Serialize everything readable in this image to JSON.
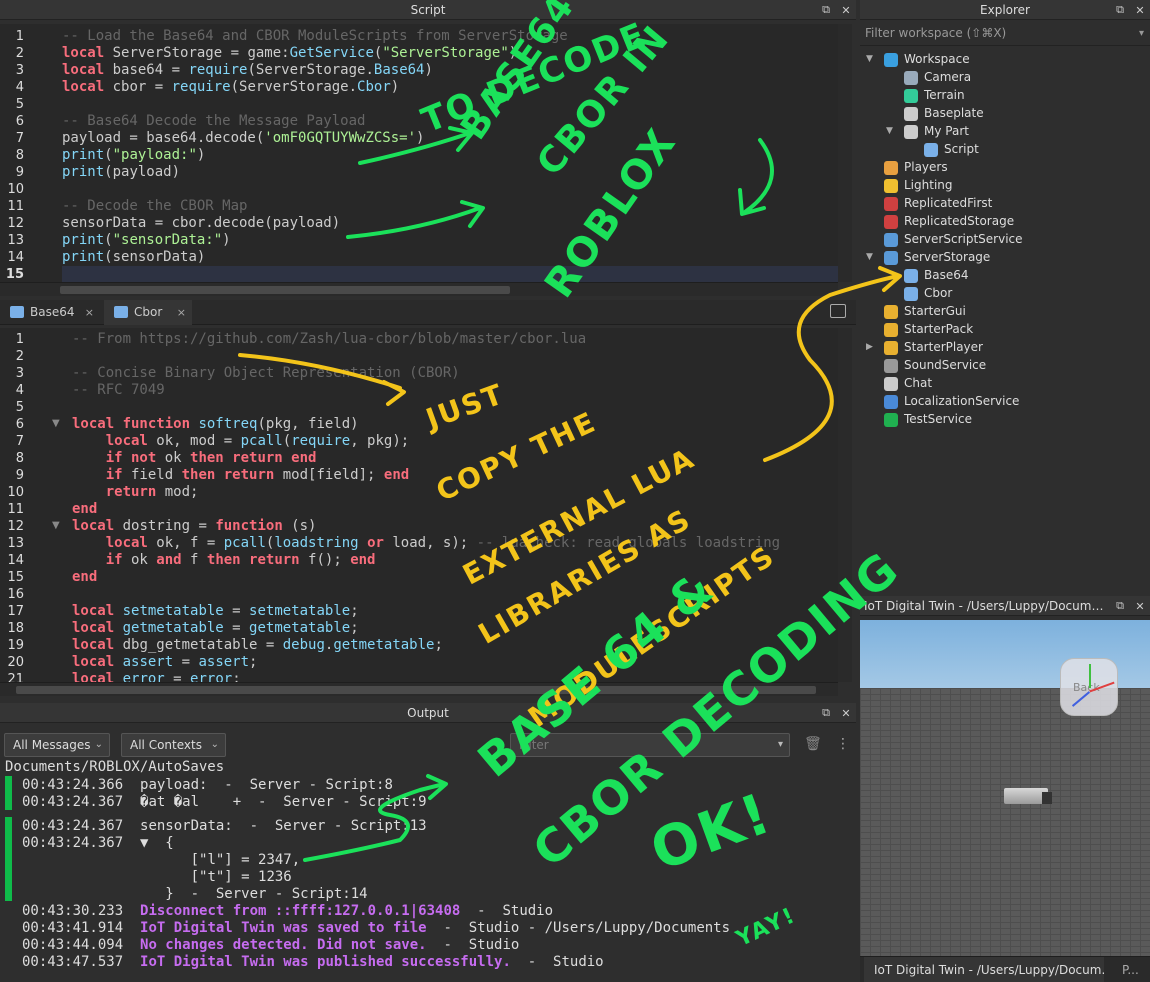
{
  "script_panel": {
    "title": "Script",
    "lines": [
      [
        {
          "c": "cm",
          "t": "-- Load the Base64 and CBOR ModuleScripts from ServerStorage"
        }
      ],
      [
        {
          "c": "kw",
          "t": "local"
        },
        {
          "c": "tx",
          "t": " ServerStorage = game:"
        },
        {
          "c": "bi",
          "t": "GetService"
        },
        {
          "c": "tx",
          "t": "("
        },
        {
          "c": "st",
          "t": "\"ServerStorage\""
        },
        {
          "c": "tx",
          "t": ")"
        }
      ],
      [
        {
          "c": "kw",
          "t": "local"
        },
        {
          "c": "tx",
          "t": " base64 = "
        },
        {
          "c": "bi",
          "t": "require"
        },
        {
          "c": "tx",
          "t": "(ServerStorage."
        },
        {
          "c": "bi",
          "t": "Base64"
        },
        {
          "c": "tx",
          "t": ")"
        }
      ],
      [
        {
          "c": "kw",
          "t": "local"
        },
        {
          "c": "tx",
          "t": " cbor = "
        },
        {
          "c": "bi",
          "t": "require"
        },
        {
          "c": "tx",
          "t": "(ServerStorage."
        },
        {
          "c": "bi",
          "t": "Cbor"
        },
        {
          "c": "tx",
          "t": ")"
        }
      ],
      [],
      [
        {
          "c": "cm",
          "t": "-- Base64 Decode the Message Payload"
        }
      ],
      [
        {
          "c": "tx",
          "t": "payload = base64.decode("
        },
        {
          "c": "st",
          "t": "'omF0GQTUYWwZCSs='"
        },
        {
          "c": "tx",
          "t": ")"
        }
      ],
      [
        {
          "c": "bi",
          "t": "print"
        },
        {
          "c": "tx",
          "t": "("
        },
        {
          "c": "st",
          "t": "\"payload:\""
        },
        {
          "c": "tx",
          "t": ")"
        }
      ],
      [
        {
          "c": "bi",
          "t": "print"
        },
        {
          "c": "tx",
          "t": "(payload)"
        }
      ],
      [],
      [
        {
          "c": "cm",
          "t": "-- Decode the CBOR Map"
        }
      ],
      [
        {
          "c": "tx",
          "t": "sensorData = cbor.decode(payload)"
        }
      ],
      [
        {
          "c": "bi",
          "t": "print"
        },
        {
          "c": "tx",
          "t": "("
        },
        {
          "c": "st",
          "t": "\"sensorData:\""
        },
        {
          "c": "tx",
          "t": ")"
        }
      ],
      [
        {
          "c": "bi",
          "t": "print"
        },
        {
          "c": "tx",
          "t": "(sensorData)"
        }
      ],
      []
    ]
  },
  "tabs": [
    {
      "label": "Base64",
      "close": "×"
    },
    {
      "label": "Cbor",
      "close": "×"
    }
  ],
  "cbor_panel": {
    "lines": [
      [
        {
          "c": "cm",
          "t": "-- From https://github.com/Zash/lua-cbor/blob/master/cbor.lua"
        }
      ],
      [],
      [
        {
          "c": "cm",
          "t": "-- Concise Binary Object Representation (CBOR)"
        }
      ],
      [
        {
          "c": "cm",
          "t": "-- RFC 7049"
        }
      ],
      [],
      [
        {
          "c": "kw",
          "t": "local function"
        },
        {
          "c": "tx",
          "t": " "
        },
        {
          "c": "bi",
          "t": "softreq"
        },
        {
          "c": "tx",
          "t": "(pkg, field)"
        }
      ],
      [
        {
          "c": "tx",
          "t": "    "
        },
        {
          "c": "kw",
          "t": "local"
        },
        {
          "c": "tx",
          "t": " ok, mod = "
        },
        {
          "c": "bi",
          "t": "pcall"
        },
        {
          "c": "tx",
          "t": "("
        },
        {
          "c": "bi",
          "t": "require"
        },
        {
          "c": "tx",
          "t": ", pkg);"
        }
      ],
      [
        {
          "c": "tx",
          "t": "    "
        },
        {
          "c": "kw",
          "t": "if not"
        },
        {
          "c": "tx",
          "t": " ok "
        },
        {
          "c": "kw",
          "t": "then return end"
        }
      ],
      [
        {
          "c": "tx",
          "t": "    "
        },
        {
          "c": "kw",
          "t": "if"
        },
        {
          "c": "tx",
          "t": " field "
        },
        {
          "c": "kw",
          "t": "then return"
        },
        {
          "c": "tx",
          "t": " mod[field]; "
        },
        {
          "c": "kw",
          "t": "end"
        }
      ],
      [
        {
          "c": "tx",
          "t": "    "
        },
        {
          "c": "kw",
          "t": "return"
        },
        {
          "c": "tx",
          "t": " mod;"
        }
      ],
      [
        {
          "c": "kw",
          "t": "end"
        }
      ],
      [
        {
          "c": "kw",
          "t": "local"
        },
        {
          "c": "tx",
          "t": " dostring = "
        },
        {
          "c": "kw",
          "t": "function"
        },
        {
          "c": "tx",
          "t": " (s)"
        }
      ],
      [
        {
          "c": "tx",
          "t": "    "
        },
        {
          "c": "kw",
          "t": "local"
        },
        {
          "c": "tx",
          "t": " ok, f = "
        },
        {
          "c": "bi",
          "t": "pcall"
        },
        {
          "c": "tx",
          "t": "("
        },
        {
          "c": "bi",
          "t": "loadstring"
        },
        {
          "c": "tx",
          "t": " "
        },
        {
          "c": "kw",
          "t": "or"
        },
        {
          "c": "tx",
          "t": " load, s); "
        },
        {
          "c": "cm",
          "t": "-- luacheck: read globals loadstring"
        }
      ],
      [
        {
          "c": "tx",
          "t": "    "
        },
        {
          "c": "kw",
          "t": "if"
        },
        {
          "c": "tx",
          "t": " ok "
        },
        {
          "c": "kw",
          "t": "and"
        },
        {
          "c": "tx",
          "t": " f "
        },
        {
          "c": "kw",
          "t": "then return"
        },
        {
          "c": "tx",
          "t": " f(); "
        },
        {
          "c": "kw",
          "t": "end"
        }
      ],
      [
        {
          "c": "kw",
          "t": "end"
        }
      ],
      [],
      [
        {
          "c": "kw",
          "t": "local"
        },
        {
          "c": "tx",
          "t": " "
        },
        {
          "c": "bi",
          "t": "setmetatable"
        },
        {
          "c": "tx",
          "t": " = "
        },
        {
          "c": "bi",
          "t": "setmetatable"
        },
        {
          "c": "tx",
          "t": ";"
        }
      ],
      [
        {
          "c": "kw",
          "t": "local"
        },
        {
          "c": "tx",
          "t": " "
        },
        {
          "c": "bi",
          "t": "getmetatable"
        },
        {
          "c": "tx",
          "t": " = "
        },
        {
          "c": "bi",
          "t": "getmetatable"
        },
        {
          "c": "tx",
          "t": ";"
        }
      ],
      [
        {
          "c": "kw",
          "t": "local"
        },
        {
          "c": "tx",
          "t": " dbg_getmetatable = "
        },
        {
          "c": "bi",
          "t": "debug"
        },
        {
          "c": "tx",
          "t": "."
        },
        {
          "c": "bi",
          "t": "getmetatable"
        },
        {
          "c": "tx",
          "t": ";"
        }
      ],
      [
        {
          "c": "kw",
          "t": "local"
        },
        {
          "c": "tx",
          "t": " "
        },
        {
          "c": "bi",
          "t": "assert"
        },
        {
          "c": "tx",
          "t": " = "
        },
        {
          "c": "bi",
          "t": "assert"
        },
        {
          "c": "tx",
          "t": ";"
        }
      ],
      [
        {
          "c": "kw",
          "t": "local"
        },
        {
          "c": "tx",
          "t": " "
        },
        {
          "c": "bi",
          "t": "error"
        },
        {
          "c": "tx",
          "t": " = "
        },
        {
          "c": "bi",
          "t": "error"
        },
        {
          "c": "tx",
          "t": ";"
        }
      ]
    ]
  },
  "output": {
    "title": "Output",
    "messages_filter": "All Messages",
    "contexts_filter": "All Contexts",
    "filter_placeholder": "Filter",
    "path": "Documents/ROBLOX/AutoSaves",
    "rows": [
      {
        "time": "00:43:24.366",
        "text": "payload:  -  Server - Script:8",
        "style": ""
      },
      {
        "time": "00:43:24.367",
        "text": "�at �al    +  -  Server - Script:9",
        "style": ""
      },
      {
        "time": "00:43:24.367",
        "text": "sensorData:  -  Server - Script:13",
        "style": ""
      },
      {
        "time": "00:43:24.367",
        "text": "▼  {",
        "style": ""
      },
      {
        "time": "",
        "text": "      [\"l\"] = 2347,",
        "style": ""
      },
      {
        "time": "",
        "text": "      [\"t\"] = 1236",
        "style": ""
      },
      {
        "time": "",
        "text": "   }  -  Server - Script:14",
        "style": ""
      },
      {
        "time": "00:43:30.233",
        "text": "Disconnect from ::ffff:127.0.0.1|63408",
        "suffix": "  -  Studio",
        "style": "purple"
      },
      {
        "time": "00:43:41.914",
        "text": "IoT Digital Twin was saved to file",
        "suffix": "  -  Studio - /Users/Luppy/Documents",
        "style": "purple"
      },
      {
        "time": "00:43:44.094",
        "text": "No changes detected. Did not save.",
        "suffix": "  -  Studio",
        "style": "purple"
      },
      {
        "time": "00:43:47.537",
        "text": "IoT Digital Twin was published successfully.",
        "suffix": "  -  Studio",
        "style": "purple"
      }
    ]
  },
  "explorer": {
    "title": "Explorer",
    "filter_placeholder": "Filter workspace (⇧⌘X)",
    "items": [
      {
        "label": "Workspace",
        "depth": 0,
        "arrow": "▼",
        "color": "#3aa0e0"
      },
      {
        "label": "Camera",
        "depth": 1,
        "arrow": "",
        "color": "#9ab"
      },
      {
        "label": "Terrain",
        "depth": 1,
        "arrow": "",
        "color": "#3c9"
      },
      {
        "label": "Baseplate",
        "depth": 1,
        "arrow": "",
        "color": "#ccc"
      },
      {
        "label": "My Part",
        "depth": 1,
        "arrow": "▼",
        "color": "#ccc"
      },
      {
        "label": "Script",
        "depth": 2,
        "arrow": "",
        "color": "#7ab0e8"
      },
      {
        "label": "Players",
        "depth": 0,
        "arrow": "",
        "color": "#e8a040"
      },
      {
        "label": "Lighting",
        "depth": 0,
        "arrow": "",
        "color": "#f0c030"
      },
      {
        "label": "ReplicatedFirst",
        "depth": 0,
        "arrow": "",
        "color": "#d04040"
      },
      {
        "label": "ReplicatedStorage",
        "depth": 0,
        "arrow": "",
        "color": "#d04040"
      },
      {
        "label": "ServerScriptService",
        "depth": 0,
        "arrow": "",
        "color": "#5a9ad8"
      },
      {
        "label": "ServerStorage",
        "depth": 0,
        "arrow": "▼",
        "color": "#5a9ad8"
      },
      {
        "label": "Base64",
        "depth": 1,
        "arrow": "",
        "color": "#7ab0e8"
      },
      {
        "label": "Cbor",
        "depth": 1,
        "arrow": "",
        "color": "#7ab0e8"
      },
      {
        "label": "StarterGui",
        "depth": 0,
        "arrow": "",
        "color": "#e8b030"
      },
      {
        "label": "StarterPack",
        "depth": 0,
        "arrow": "",
        "color": "#e8b030"
      },
      {
        "label": "StarterPlayer",
        "depth": 0,
        "arrow": "▶",
        "color": "#e8b030"
      },
      {
        "label": "SoundService",
        "depth": 0,
        "arrow": "",
        "color": "#999"
      },
      {
        "label": "Chat",
        "depth": 0,
        "arrow": "",
        "color": "#ccc"
      },
      {
        "label": "LocalizationService",
        "depth": 0,
        "arrow": "",
        "color": "#4a8ad8"
      },
      {
        "label": "TestService",
        "depth": 0,
        "arrow": "",
        "color": "#20b050"
      }
    ]
  },
  "viewport": {
    "title": "IoT Digital Twin - /Users/Luppy/Documents/...",
    "cube_label": "Back",
    "tab_label": "IoT Digital Twin - /Users/Luppy/Docum...",
    "tab2_label": "P..."
  },
  "annotations": {
    "green_top": [
      "TO DECODE",
      "BASE64 &",
      "CBOR IN",
      "ROBLOX"
    ],
    "yellow": [
      "JUST",
      "COPY THE",
      "EXTERNAL LUA",
      "LIBRARIES AS",
      "MODULESCRIPTS"
    ],
    "green_bottom": [
      "BASE 64 &",
      "CBOR DECODING",
      "OK!"
    ],
    "yay": "YAY!"
  },
  "colors": {
    "accent_green": "#1be15a",
    "accent_yellow": "#f3c41a",
    "purple": "#c66cf0"
  }
}
